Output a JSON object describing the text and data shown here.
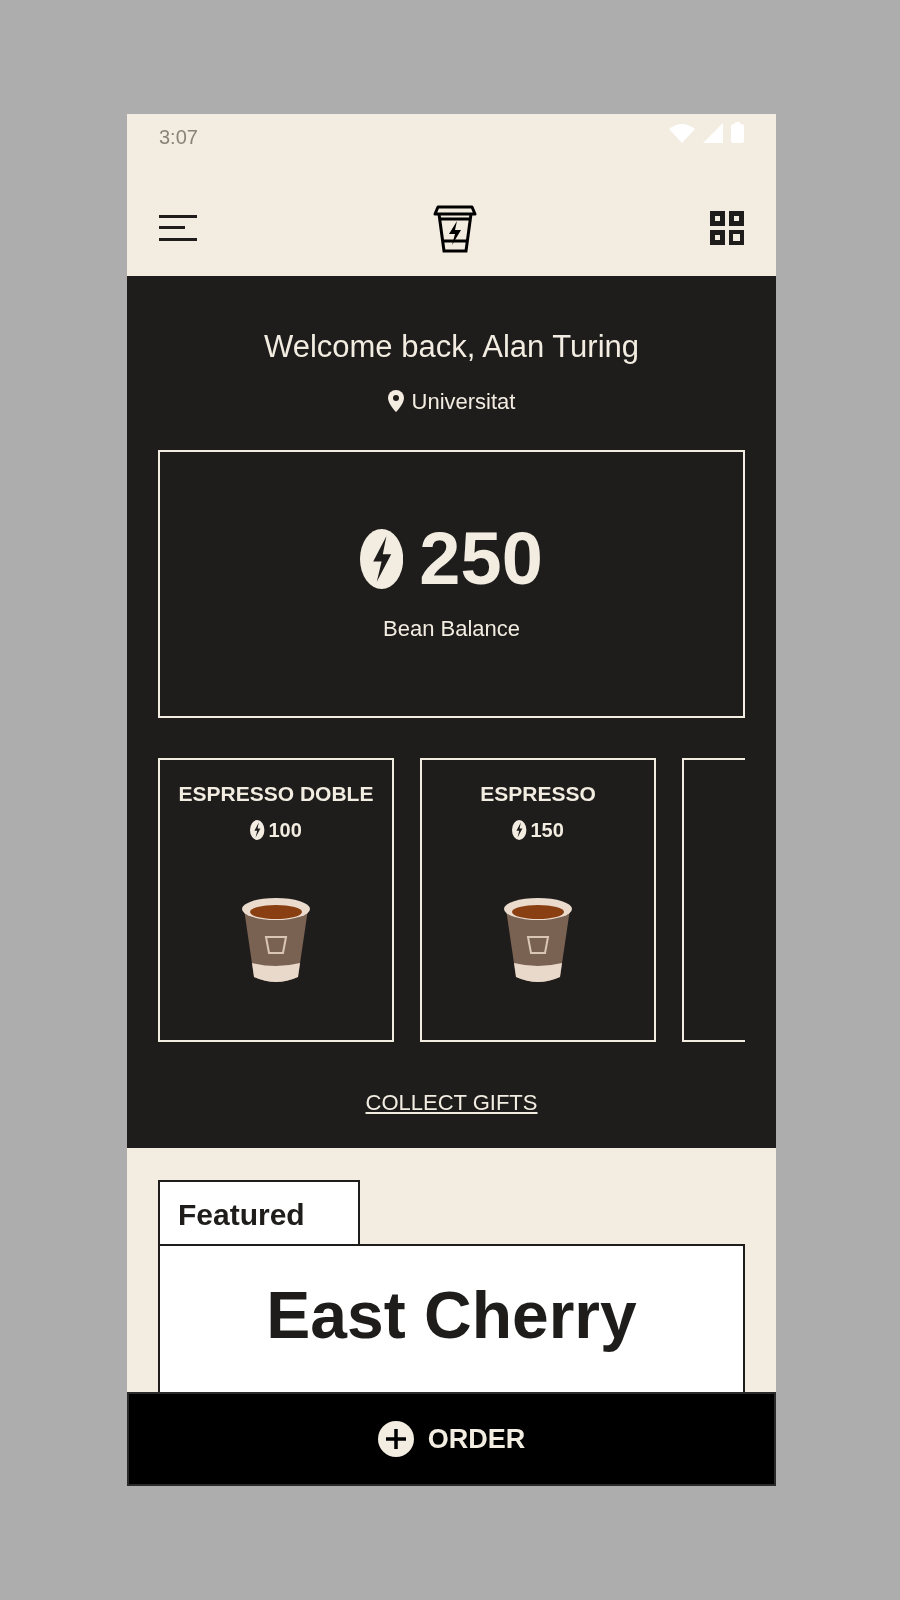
{
  "status_bar": {
    "time": "3:07"
  },
  "header": {
    "greeting": "Welcome back, Alan Turing",
    "location": "Universitat"
  },
  "balance": {
    "amount": "250",
    "label": "Bean Balance"
  },
  "rewards": [
    {
      "name": "ESPRESSO DOBLE",
      "price": "100",
      "kind": "item"
    },
    {
      "name": "ESPRESSO",
      "price": "150",
      "kind": "item"
    },
    {
      "kind": "partial"
    }
  ],
  "collect_link": "COLLECT GIFTS",
  "featured": {
    "tab": "Featured",
    "title": "East Cherry"
  },
  "order_button": "ORDER"
}
